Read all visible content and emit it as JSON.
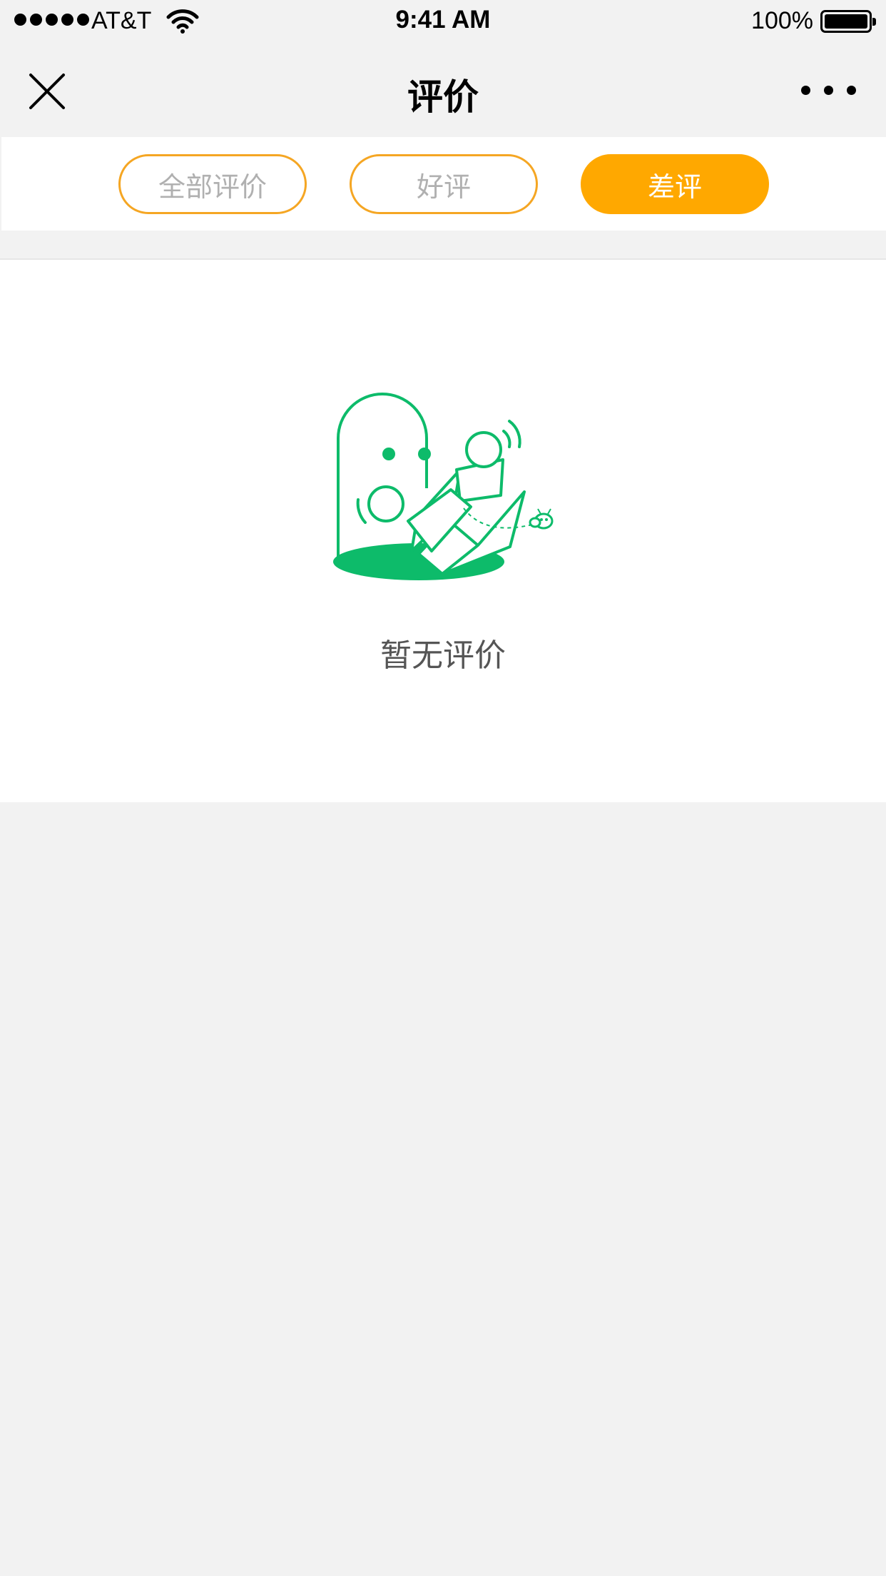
{
  "status_bar": {
    "carrier": "AT&T",
    "time": "9:41 AM",
    "battery": "100%"
  },
  "nav": {
    "title": "评价",
    "close_icon": "close-icon",
    "more_icon": "more-icon"
  },
  "filters": {
    "tabs": [
      {
        "label": "全部评价",
        "active": false
      },
      {
        "label": "好评",
        "active": false
      },
      {
        "label": "差评",
        "active": true
      }
    ]
  },
  "empty_state": {
    "illustration": "robot-box-illustration",
    "message": "暂无评价"
  },
  "colors": {
    "accent": "#ffa800",
    "tab_border": "#f5a623",
    "illustration": "#0dbb6a",
    "background": "#f2f2f2"
  }
}
